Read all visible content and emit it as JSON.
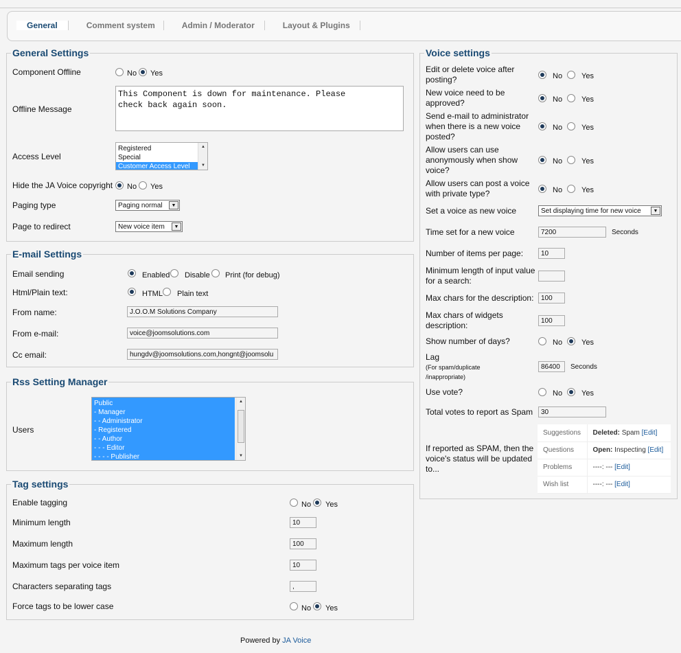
{
  "tabs": [
    {
      "label": "General"
    },
    {
      "label": "Comment system"
    },
    {
      "label": "Admin / Moderator"
    },
    {
      "label": "Layout & Plugins"
    }
  ],
  "general": {
    "legend": "General Settings",
    "component_offline": {
      "label": "Component Offline",
      "no": "No",
      "yes": "Yes",
      "selected": "Yes"
    },
    "offline_message": {
      "label": "Offline Message",
      "value": "This Component is down for maintenance. Please\ncheck back again soon."
    },
    "access_level": {
      "label": "Access Level",
      "options": [
        "Registered",
        "Special",
        "Customer Access Level"
      ],
      "selected": "Customer Access Level"
    },
    "hide_copyright": {
      "label": "Hide the JA Voice copyright",
      "no": "No",
      "yes": "Yes",
      "selected": "No"
    },
    "paging_type": {
      "label": "Paging type",
      "value": "Paging normal"
    },
    "page_redirect": {
      "label": "Page to redirect",
      "value": "New voice item"
    }
  },
  "email": {
    "legend": "E-mail Settings",
    "sending": {
      "label": "Email sending",
      "enabled": "Enabled",
      "disable": "Disable",
      "print": "Print (for debug)",
      "selected": "Enabled"
    },
    "format": {
      "label": "Html/Plain text:",
      "html": "HTML",
      "plain": "Plain text",
      "selected": "HTML"
    },
    "from_name": {
      "label": "From name:",
      "value": "J.O.O.M Solutions Company"
    },
    "from_email": {
      "label": "From e-mail:",
      "value": "voice@joomsolutions.com"
    },
    "cc_email": {
      "label": "Cc email:",
      "value": "hungdv@joomsolutions.com,hongnt@joomsolu"
    }
  },
  "rss": {
    "legend": "Rss Setting Manager",
    "users_label": "Users",
    "users": [
      "Public",
      "- Manager",
      "- - Administrator",
      "- Registered",
      "- - Author",
      "- - - Editor",
      "- - - - Publisher"
    ]
  },
  "tags": {
    "legend": "Tag settings",
    "enable": {
      "label": "Enable tagging",
      "no": "No",
      "yes": "Yes",
      "selected": "Yes"
    },
    "min_length": {
      "label": "Minimum length",
      "value": "10"
    },
    "max_length": {
      "label": "Maximum length",
      "value": "100"
    },
    "max_per_item": {
      "label": "Maximum tags per voice item",
      "value": "10"
    },
    "separator": {
      "label": "Characters separating tags",
      "value": ","
    },
    "lower_case": {
      "label": "Force tags to be lower case",
      "no": "No",
      "yes": "Yes",
      "selected": "Yes"
    }
  },
  "voice": {
    "legend": "Voice settings",
    "edit_delete": {
      "label": "Edit or delete voice after posting?",
      "no": "No",
      "yes": "Yes",
      "selected": "No"
    },
    "need_approve": {
      "label": "New voice need to be approved?",
      "no": "No",
      "yes": "Yes",
      "selected": "No"
    },
    "email_admin": {
      "label": "Send e-mail to administrator when there is a new voice posted?",
      "no": "No",
      "yes": "Yes",
      "selected": "No"
    },
    "anonymous": {
      "label": "Allow users can use anonymously when show voice?",
      "no": "No",
      "yes": "Yes",
      "selected": "No"
    },
    "private": {
      "label": "Allow users can post a voice with private type?",
      "no": "No",
      "yes": "Yes",
      "selected": "No"
    },
    "set_new": {
      "label": "Set a voice as new voice",
      "value": "Set displaying time for new voice"
    },
    "time_new": {
      "label": "Time set for a new voice",
      "value": "7200",
      "unit": "Seconds"
    },
    "items_per_page": {
      "label": "Number of items per page:",
      "value": "10"
    },
    "min_search": {
      "label": "Minimum length of input value for a search:",
      "value": ""
    },
    "max_desc": {
      "label": "Max chars for the description:",
      "value": "100"
    },
    "max_widget_desc": {
      "label": "Max chars of widgets description:",
      "value": "100"
    },
    "show_days": {
      "label": "Show number of days?",
      "no": "No",
      "yes": "Yes",
      "selected": "Yes"
    },
    "lag": {
      "label": "Lag",
      "note": "(For spam/duplicate /inappropriate)",
      "value": "86400",
      "unit": "Seconds"
    },
    "use_vote": {
      "label": "Use vote?",
      "no": "No",
      "yes": "Yes",
      "selected": "Yes"
    },
    "votes_spam": {
      "label": "Total votes to report as Spam",
      "value": "30"
    },
    "spam_status": {
      "label": "If reported as SPAM, then the voice's status will be updated to...",
      "rows": [
        {
          "cat": "Suggestions",
          "state": "Deleted:",
          "detail": "Spam",
          "edit": "[Edit]"
        },
        {
          "cat": "Questions",
          "state": "Open:",
          "detail": "Inspecting",
          "edit": "[Edit]"
        },
        {
          "cat": "Problems",
          "state": "",
          "detail": "----: ---",
          "edit": "[Edit]"
        },
        {
          "cat": "Wish list",
          "state": "",
          "detail": "----: ---",
          "edit": "[Edit]"
        }
      ]
    }
  },
  "footer": {
    "prefix": "Powered by",
    "link": "JA Voice"
  }
}
